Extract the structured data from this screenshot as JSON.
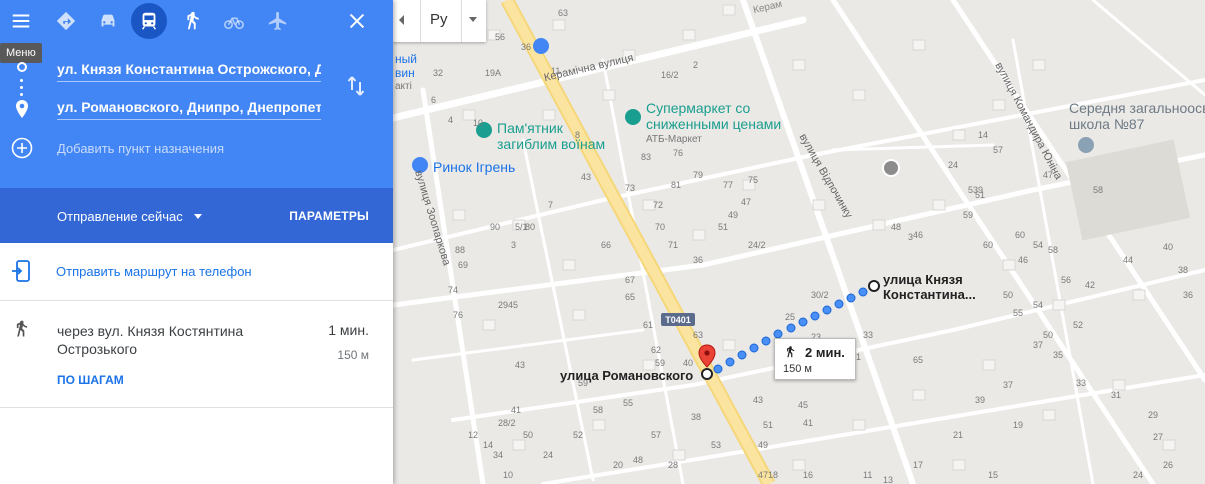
{
  "sidebar": {
    "tooltip": "Меню",
    "origin": "ул. Князя Константина Острожского, Д",
    "destination": "ул. Романовского, Днипро, Днепропетровская",
    "add_destination": "Добавить пункт назначения",
    "depart": "Отправление сейчас",
    "options": "ПАРАМЕТРЫ",
    "send_to_phone": "Отправить маршрут на телефон",
    "route": {
      "via": "через вул. Князя Костянтина Острозького",
      "time": "1 мин.",
      "distance": "150 м",
      "steps": "ПО ШАГАМ"
    },
    "icons": [
      "menu-icon",
      "directions-icon",
      "car-icon",
      "transit-icon",
      "walk-icon",
      "bike-icon",
      "flight-icon",
      "close-icon"
    ]
  },
  "map": {
    "language": "Ру",
    "labels": {
      "supermarket": "Супермаркет со",
      "supermarket2": "сниженными ценами",
      "supermarket3": "АТБ-Маркет",
      "monument": "Пам'ятник",
      "monument2": "загиблим воїнам",
      "market": "Ринок Ігрень",
      "school": "Середня загальноосвітня",
      "school2": "школа №87",
      "start": "улица Князя",
      "start2": "Константина...",
      "end": "улица Романовского",
      "road": "T0401",
      "street_keramichna": "Керамічна вулиця",
      "street_vidpochynku": "вулиця Відпочинку",
      "street_komandyra": "вулиця Командира Юніна",
      "street_zoo": "вулиця Зоопаркова",
      "partial_top": "Керам",
      "partial_left": "ный",
      "partial_left2": "вин",
      "partial_left3": "акті"
    },
    "callout": {
      "time": "2 мин.",
      "distance": "150 м"
    },
    "numbers": [
      "63",
      "34",
      "19A",
      "11",
      "16/2",
      "2",
      "32",
      "6",
      "4",
      "10",
      "8",
      "56",
      "36",
      "59",
      "60",
      "54",
      "24",
      "9",
      "14",
      "47",
      "58",
      "57",
      "50",
      "55",
      "43",
      "73",
      "76",
      "83",
      "81",
      "79",
      "77",
      "75",
      "53",
      "51",
      "7",
      "5/1",
      "3",
      "72",
      "70",
      "71",
      "66",
      "24/2",
      "3",
      "80",
      "90",
      "88",
      "69",
      "67",
      "65",
      "74",
      "76",
      "29",
      "36",
      "51",
      "49",
      "47",
      "45",
      "43",
      "41",
      "28/2",
      "30/2",
      "25",
      "23",
      "33",
      "31",
      "48",
      "46",
      "60",
      "58",
      "56",
      "54",
      "52",
      "50",
      "65",
      "62",
      "63",
      "61",
      "59",
      "40",
      "38",
      "59",
      "55",
      "58",
      "57",
      "53",
      "51",
      "49",
      "47",
      "45",
      "43",
      "41",
      "39",
      "37",
      "37",
      "35",
      "33",
      "31",
      "29",
      "27",
      "26",
      "24",
      "21",
      "19",
      "17",
      "15",
      "13",
      "11",
      "16",
      "18",
      "28",
      "20",
      "10",
      "12",
      "14",
      "34",
      "24",
      "50",
      "52",
      "48",
      "46",
      "42",
      "44",
      "40",
      "38",
      "36"
    ]
  }
}
